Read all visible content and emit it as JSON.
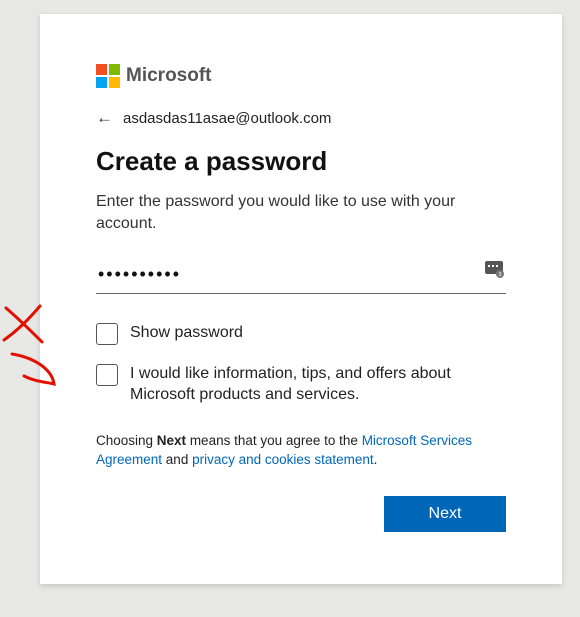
{
  "brand": {
    "name": "Microsoft"
  },
  "identity": {
    "email": "asdasdas11asae@outlook.com"
  },
  "heading": "Create a password",
  "subtext": "Enter the password you would like to use with your account.",
  "password": {
    "masked_value": "••••••••••"
  },
  "checkboxes": {
    "show_password": "Show password",
    "marketing_optin": "I would like information, tips, and offers about Microsoft products and services."
  },
  "legal": {
    "prefix": "Choosing ",
    "bold": "Next",
    "mid": " means that you agree to the ",
    "link1": "Microsoft Services Agreement",
    "and": " and ",
    "link2": "privacy and cookies statement",
    "suffix": "."
  },
  "buttons": {
    "next": "Next"
  }
}
